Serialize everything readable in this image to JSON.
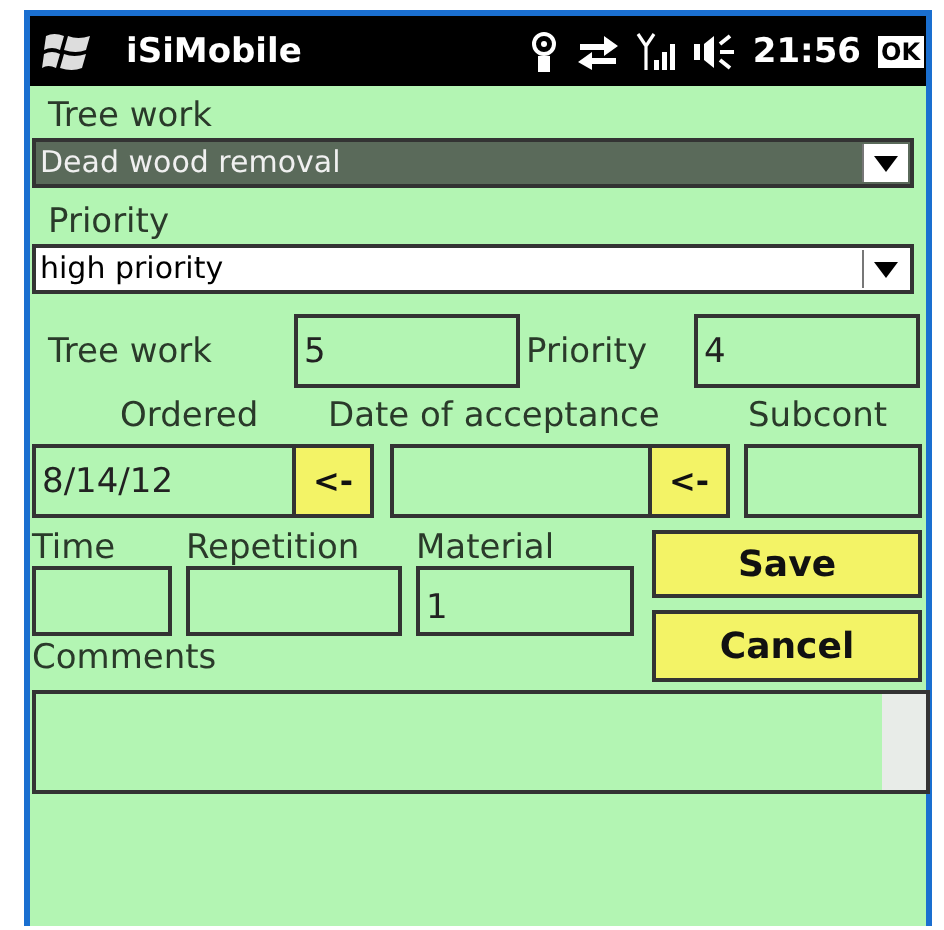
{
  "title_bar": {
    "title": "iSiMobile",
    "time": "21:56",
    "ok": "OK"
  },
  "dropdowns": [
    {
      "label": "Tree work",
      "value": "Dead wood removal",
      "focused": true
    },
    {
      "label": "Priority",
      "value": "high priority",
      "focused": false
    }
  ],
  "codes": [
    {
      "label": "Tree work",
      "value": "5"
    },
    {
      "label": "Priority",
      "value": "4"
    }
  ],
  "dates": [
    {
      "label": "Ordered",
      "value": "8/14/12",
      "button": "<-"
    },
    {
      "label": "Date of acceptance",
      "button": "<-"
    }
  ],
  "subcont": {
    "label": "Subcont"
  },
  "small_fields": [
    {
      "label": "Time"
    },
    {
      "label": "Repetition"
    },
    {
      "label": "Material",
      "value": "1"
    }
  ],
  "buttons": [
    "Save",
    "Cancel"
  ],
  "comments": {
    "label": "Comments"
  }
}
